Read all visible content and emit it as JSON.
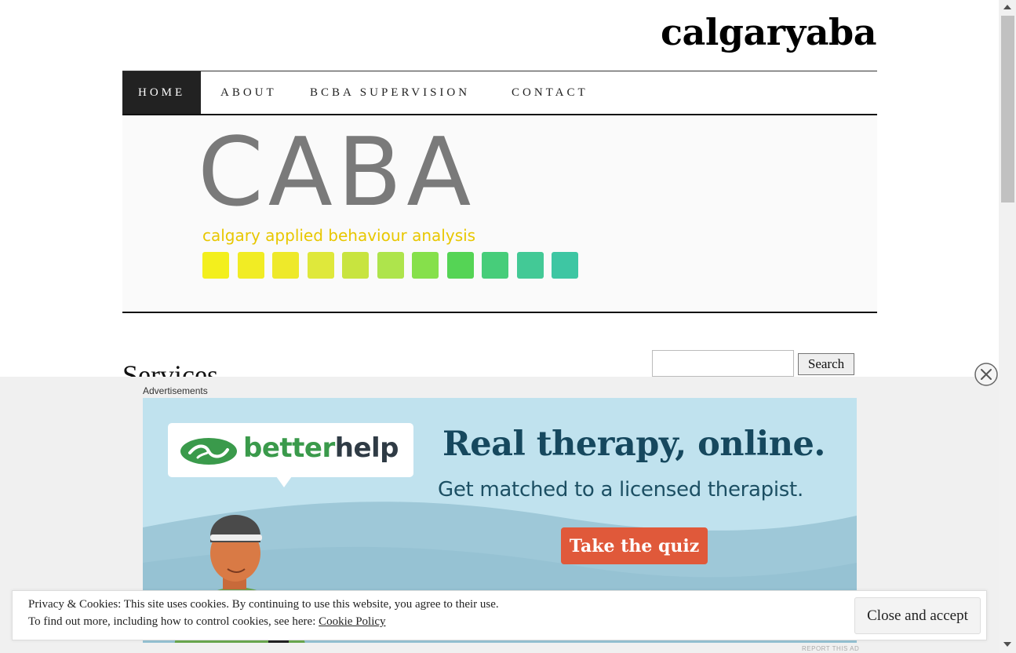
{
  "site": {
    "title": "calgaryaba"
  },
  "nav": {
    "items": [
      {
        "label": "HOME"
      },
      {
        "label": "ABOUT"
      },
      {
        "label": "BCBA SUPERVISION"
      },
      {
        "label": "CONTACT"
      }
    ]
  },
  "header_image": {
    "title": "CABA",
    "subtitle": "calgary applied behaviour analysis",
    "square_colors": [
      "#f3ef1d",
      "#f1ec24",
      "#eee92a",
      "#dfe83b",
      "#c8e43f",
      "#aee44c",
      "#86e04b",
      "#55d455",
      "#47cd7a",
      "#43c996",
      "#3ec6a3"
    ]
  },
  "main": {
    "heading": "Services"
  },
  "search": {
    "placeholder": "",
    "button_label": "Search"
  },
  "ad": {
    "label": "Advertisements",
    "brand_part1": "better",
    "brand_part2": "help",
    "headline": "Real therapy, online.",
    "subline": "Get matched to a licensed therapist.",
    "cta": "Take the quiz",
    "report": "REPORT THIS AD",
    "colors": {
      "background": "#c0e2ee",
      "headline": "#16485e",
      "cta": "#e0593a",
      "brand_green": "#3a9a4b"
    }
  },
  "cookie": {
    "line1": "Privacy & Cookies: This site uses cookies. By continuing to use this website, you agree to their use.",
    "line2_prefix": "To find out more, including how to control cookies, see here:",
    "link": "Cookie Policy",
    "accept": "Close and accept"
  },
  "icons": [
    "close-circle-icon",
    "betterhelp-logo-icon",
    "scroll-up-arrow-icon",
    "scroll-down-arrow-icon"
  ]
}
